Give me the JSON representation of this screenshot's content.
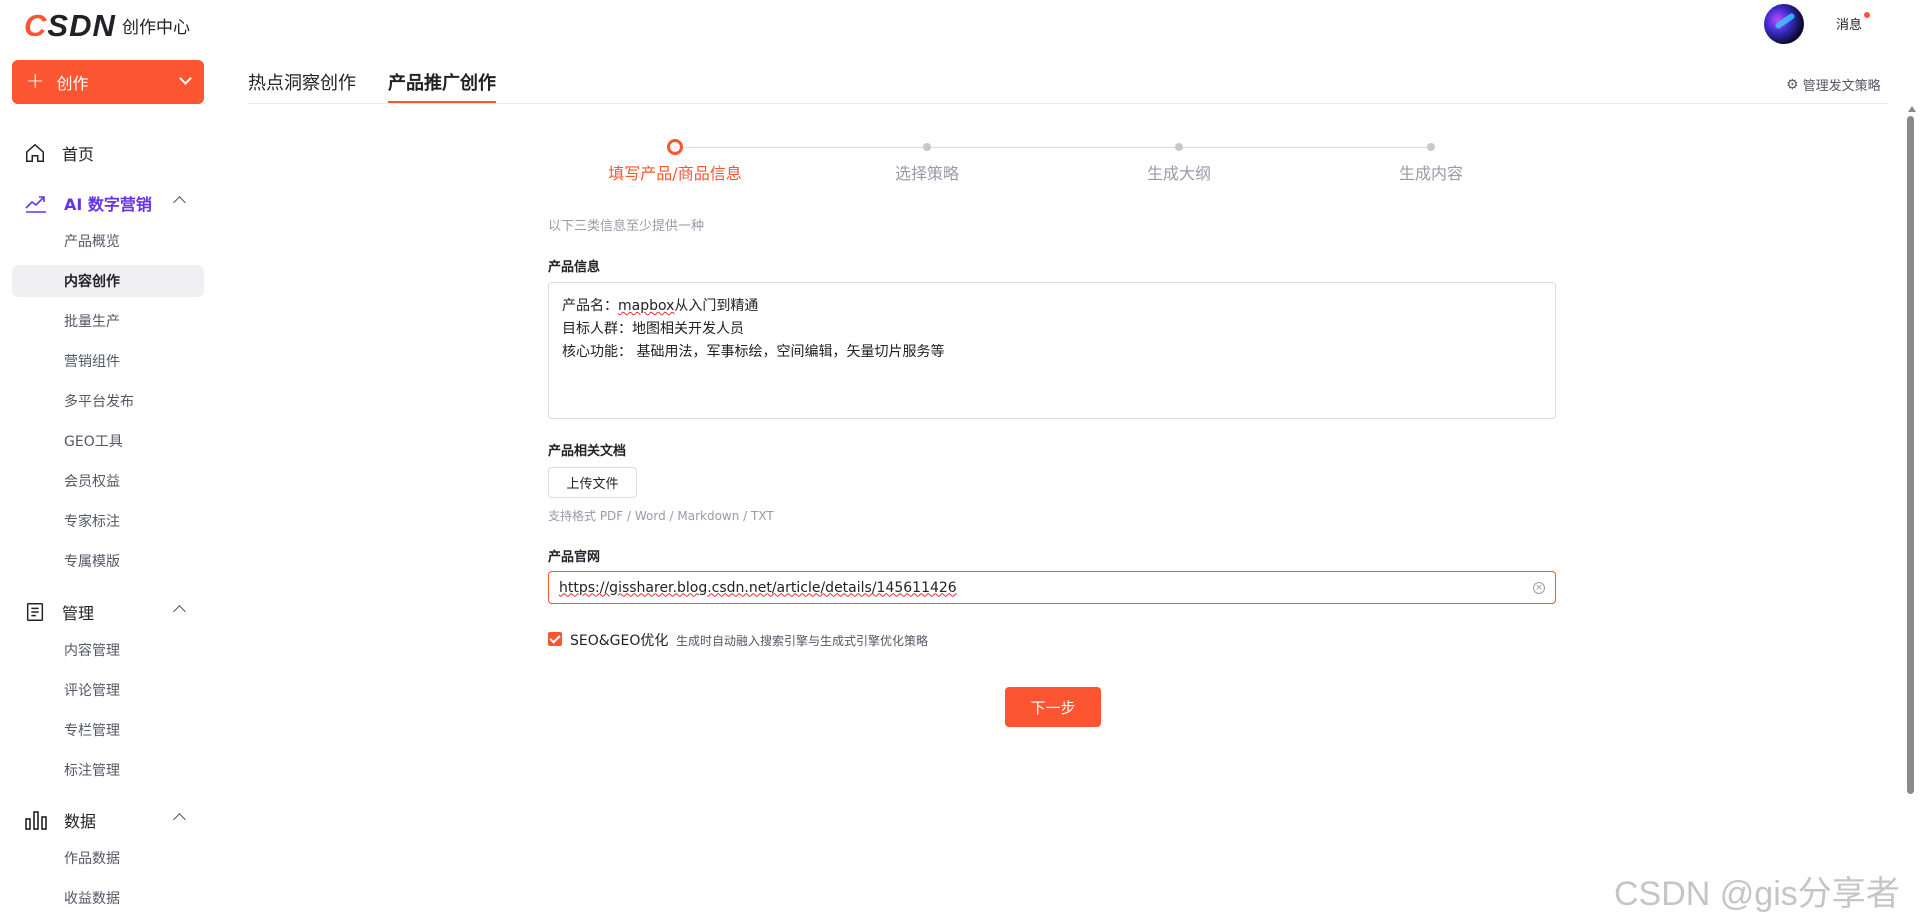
{
  "header": {
    "logo_text": "CSDN",
    "subtitle": "创作中心",
    "message_label": "消息",
    "accent": "#fc5531"
  },
  "sidebar": {
    "create_label": "创作",
    "home_label": "首页",
    "groups": [
      {
        "label": "AI 数字营销",
        "icon": "trend-chart-icon",
        "items": [
          "产品概览",
          "内容创作",
          "批量生产",
          "营销组件",
          "多平台发布",
          "GEO工具",
          "会员权益",
          "专家标注",
          "专属模版"
        ],
        "active_item": "内容创作"
      },
      {
        "label": "管理",
        "icon": "document-icon",
        "items": [
          "内容管理",
          "评论管理",
          "专栏管理",
          "标注管理"
        ]
      },
      {
        "label": "数据",
        "icon": "bar-chart-icon",
        "items": [
          "作品数据",
          "收益数据"
        ]
      }
    ]
  },
  "tabs": [
    {
      "label": "热点洞察创作",
      "active": false
    },
    {
      "label": "产品推广创作",
      "active": true
    }
  ],
  "manage_strategy": "管理发文策略",
  "steps": [
    {
      "label": "填写产品/商品信息",
      "active": true
    },
    {
      "label": "选择策略",
      "active": false
    },
    {
      "label": "生成大纲",
      "active": false
    },
    {
      "label": "生成内容",
      "active": false
    }
  ],
  "form": {
    "hint": "以下三类信息至少提供一种",
    "product_info_label": "产品信息",
    "product_info_lines": [
      {
        "prefix": "产品名：",
        "wavy": "mapbox",
        "suffix": "从入门到精通"
      },
      {
        "prefix": "目标人群：地图相关开发人员",
        "wavy": "",
        "suffix": ""
      },
      {
        "prefix": "核心功能： 基础用法，军事标绘，空间编辑，矢量切片服务等",
        "wavy": "",
        "suffix": ""
      }
    ],
    "docs_label": "产品相关文档",
    "upload_label": "上传文件",
    "formats": "支持格式 PDF / Word / Markdown / TXT",
    "website_label": "产品官网",
    "website_value": "https://gissharer.blog.csdn.net/article/details/145611426",
    "seo_checked": true,
    "seo_label": "SEO&GEO优化",
    "seo_desc": "生成时自动融入搜索引擎与生成式引擎优化策略",
    "next_label": "下一步"
  },
  "watermark": "CSDN @gis分享者"
}
